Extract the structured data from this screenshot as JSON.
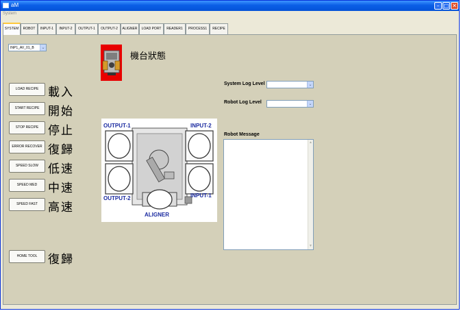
{
  "window": {
    "title": "aM",
    "menu": "System",
    "controls": {
      "minimize": "–",
      "maximize": "□",
      "close": "✕"
    }
  },
  "tabs": [
    {
      "label": "SYSTEM",
      "active": true
    },
    {
      "label": "ROBOT"
    },
    {
      "label": "INPUT-1"
    },
    {
      "label": "INPUT-2"
    },
    {
      "label": "OUTPUT-1"
    },
    {
      "label": "OUTPUT-2"
    },
    {
      "label": "ALIGNER"
    },
    {
      "label": "LOAD PORT"
    },
    {
      "label": "READER1"
    },
    {
      "label": "PROCESS1"
    },
    {
      "label": "RECIPE"
    }
  ],
  "port_select": {
    "value": "INP1_AV_01_B",
    "arrow": "⌄"
  },
  "machine_status": {
    "title": "機台狀態",
    "icon": "machine-icon"
  },
  "commands": [
    {
      "button": "LOAD RECIPE",
      "label": "載入"
    },
    {
      "button": "START RECIPE",
      "label": "開始"
    },
    {
      "button": "STOP RECIPE",
      "label": "停止"
    },
    {
      "button": "ERROR RECOVER",
      "label": "復歸"
    },
    {
      "button": "SPEED SLOW",
      "label": "低速"
    },
    {
      "button": "SPEED MED",
      "label": "中速"
    },
    {
      "button": "SPEED FAST",
      "label": "高速"
    }
  ],
  "home": {
    "button": "HOME TOOL",
    "label": "復歸"
  },
  "diagram": {
    "output1": "OUTPUT-1",
    "input2": "INPUT-2",
    "output2": "OUTPUT-2",
    "input1": "INPUT-1",
    "aligner": "ALIGNER"
  },
  "log_levels": {
    "system_label": "System Log Level",
    "system_value": "",
    "robot_label": "Robot Log Level",
    "robot_value": ""
  },
  "robot_message": {
    "label": "Robot Message",
    "text": ""
  },
  "colors": {
    "title_bar": "#0a5ee6",
    "panel": "#d4d0b9",
    "machine_bg": "#e80000",
    "diagram_text": "#1a2aa0"
  }
}
